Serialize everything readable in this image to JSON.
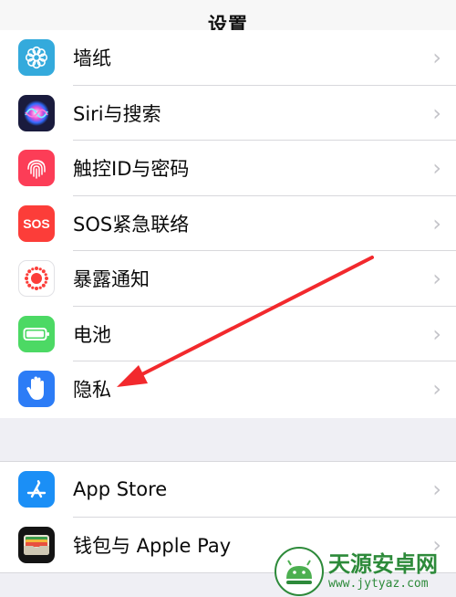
{
  "header": {
    "title": "设置"
  },
  "group1": {
    "items": [
      {
        "label": "墙纸",
        "icon": "wallpaper-flower-icon"
      },
      {
        "label": "Siri与搜索",
        "icon": "siri-icon"
      },
      {
        "label": "触控ID与密码",
        "icon": "fingerprint-icon"
      },
      {
        "label": "SOS紧急联络",
        "icon": "sos-icon",
        "icon_text": "SOS"
      },
      {
        "label": "暴露通知",
        "icon": "exposure-notification-icon"
      },
      {
        "label": "电池",
        "icon": "battery-icon"
      },
      {
        "label": "隐私",
        "icon": "privacy-hand-icon"
      }
    ]
  },
  "group2": {
    "items": [
      {
        "label": "App Store",
        "icon": "app-store-icon"
      },
      {
        "label": "钱包与 Apple Pay",
        "icon": "wallet-icon"
      }
    ]
  },
  "chevron": "›",
  "annotation": {
    "color": "#f2292d",
    "target": "隐私"
  },
  "watermark": {
    "name": "天源安卓网",
    "url": "www.jytyaz.com"
  },
  "colors": {
    "nav_background": "#f7f7f7",
    "group_background": "#efeff4",
    "accent": "#2c7cf6"
  }
}
